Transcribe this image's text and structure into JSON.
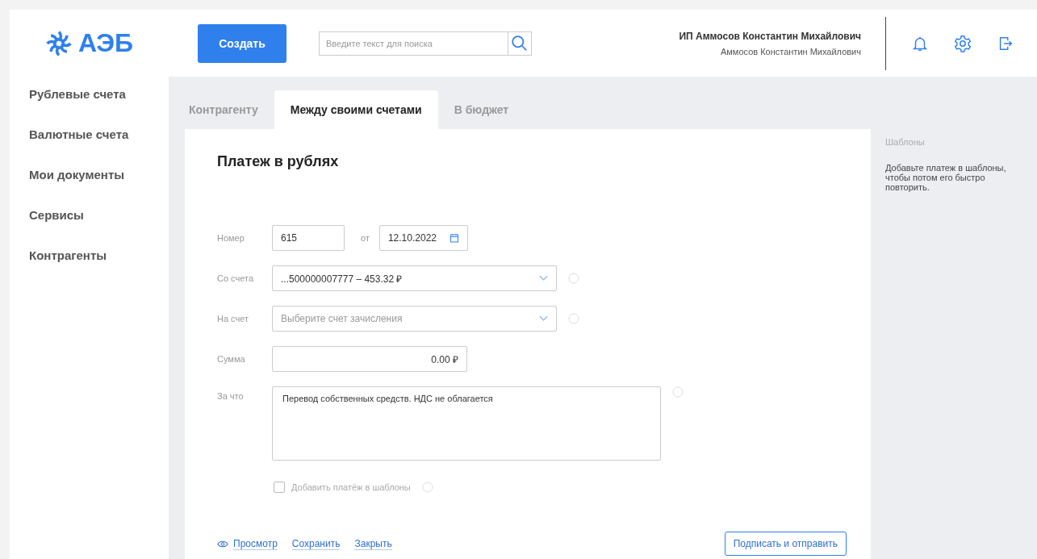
{
  "header": {
    "logo": "АЭБ",
    "create_button": "Создать",
    "search": {
      "placeholder": "Введите текст для поиска"
    },
    "company": "ИП Аммосов Константин Михайлович",
    "user": "Аммосов Константин Михайлович"
  },
  "sidebar": {
    "items": [
      {
        "label": "Рублевые счета",
        "selected": false
      },
      {
        "label": "Валютные счета",
        "selected": false
      },
      {
        "label": "Мои документы",
        "selected": false
      },
      {
        "label": "Сервисы",
        "selected": false
      },
      {
        "label": "Контрагенты",
        "selected": false
      }
    ]
  },
  "tabs": [
    {
      "label": "Контрагенту",
      "selected": false
    },
    {
      "label": "Между своими счетами",
      "selected": true
    },
    {
      "label": "В бюджет",
      "selected": false
    }
  ],
  "form": {
    "title": "Платеж в рублях",
    "number": {
      "label": "Номер",
      "value": "615",
      "date_label": "от",
      "date": "12.10.2022"
    },
    "fields": [
      {
        "kind": "select",
        "label": "Со счета",
        "value": "...500000007777 – 453.32 ₽",
        "help": true
      },
      {
        "kind": "select",
        "label": "На счет",
        "placeholder": "Выберите счет зачисления",
        "help": true
      },
      {
        "kind": "amount",
        "label": "Сумма",
        "value": "0.00 ₽",
        "help": false
      },
      {
        "kind": "textarea",
        "label": "За что",
        "value": "Перевод собственных средств. НДС не облагается",
        "help": true
      }
    ],
    "template_checkbox": {
      "label": "Добавить платёж в шаблоны",
      "checked": false
    },
    "links": [
      {
        "label": "Просмотр",
        "icon": true
      },
      {
        "label": "Сохранить",
        "icon": false
      },
      {
        "label": "Закрыть",
        "icon": false
      }
    ],
    "submit": "Подписать и отправить"
  },
  "templates": {
    "title": "Шаблоны",
    "hint": "Добавьте платеж в шаблоны, чтобы потом его быстро повторить."
  }
}
